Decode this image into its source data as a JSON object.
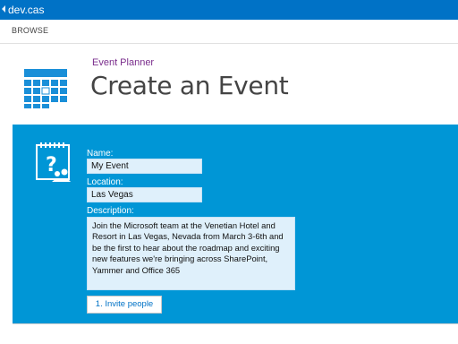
{
  "topbar": {
    "site_title": "dev.cas"
  },
  "ribbon": {
    "browse_label": "BROWSE"
  },
  "header": {
    "app_name": "Event Planner",
    "page_title": "Create an Event"
  },
  "form": {
    "name_label": "Name:",
    "name_value": "My Event",
    "location_label": "Location:",
    "location_value": "Las Vegas",
    "description_label": "Description:",
    "description_value": "Join the Microsoft team at the Venetian Hotel and Resort in Las Vegas, Nevada from March 3-6th and be the first to hear about the roadmap and exciting new features we're bringing across SharePoint, Yammer and Office 365",
    "invite_button_label": "1. Invite people"
  },
  "colors": {
    "suite_bar": "#0072c6",
    "panel": "#0096d6",
    "breadcrumb": "#7a2d8c"
  },
  "icons": {
    "app_tile": "calendar-grid-icon",
    "event": "event-question-icon"
  }
}
